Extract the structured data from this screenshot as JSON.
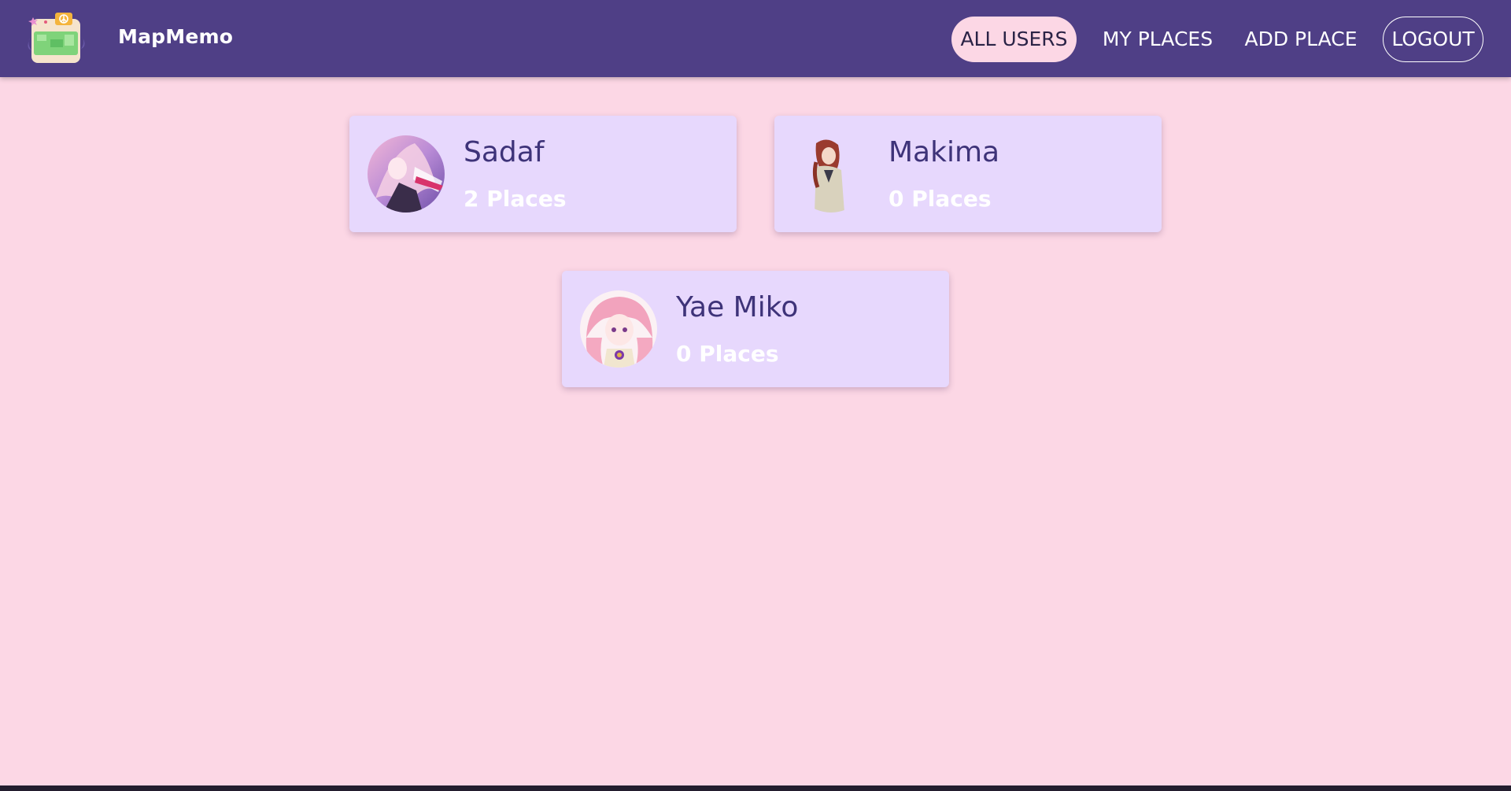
{
  "app": {
    "brand": "MapMemo",
    "logo_icon": "map-logo-icon"
  },
  "nav": {
    "all_users": "ALL USERS",
    "my_places": "MY PLACES",
    "add_place": "ADD PLACE",
    "logout": "LOGOUT",
    "active": "ALL USERS"
  },
  "users": [
    {
      "name": "Sadaf",
      "places": "2 Places",
      "avatar": "avatar-sadaf"
    },
    {
      "name": "Makima",
      "places": "0 Places",
      "avatar": "avatar-makima"
    },
    {
      "name": "Yae Miko",
      "places": "0 Places",
      "avatar": "avatar-yae-miko"
    }
  ],
  "colors": {
    "header": "#4f3f86",
    "background": "#fcd7e5",
    "card": "#e7d8fd",
    "name_text": "#3e3379",
    "count_text": "#ffffff"
  }
}
